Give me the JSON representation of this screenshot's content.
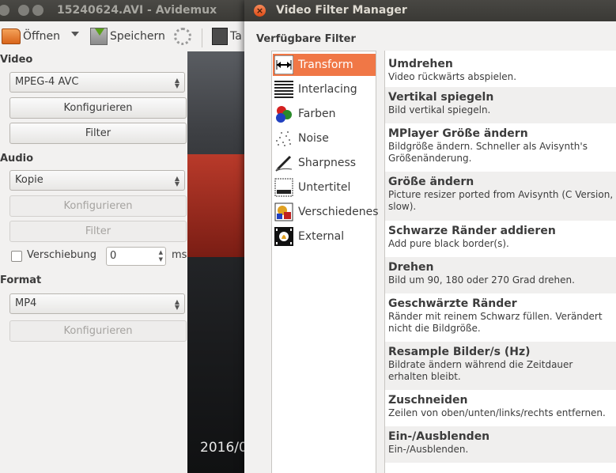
{
  "main_window": {
    "title": "15240624.AVI - Avidemux",
    "toolbar": {
      "open_label": "Öffnen",
      "save_label": "Speichern",
      "calc_label": "Ta"
    },
    "video": {
      "section_label": "Video",
      "codec_value": "MPEG-4 AVC",
      "configure_label": "Konfigurieren",
      "filter_label": "Filter"
    },
    "audio": {
      "section_label": "Audio",
      "codec_value": "Kopie",
      "configure_label": "Konfigurieren",
      "filter_label": "Filter",
      "shift_label": "Verschiebung",
      "shift_value": "0",
      "shift_unit": "ms"
    },
    "format": {
      "section_label": "Format",
      "container_value": "MP4",
      "configure_label": "Konfigurieren"
    },
    "preview": {
      "timestamp": "2016/0"
    }
  },
  "dialog": {
    "title": "Video Filter Manager",
    "available_label": "Verfügbare Filter",
    "categories": [
      {
        "label": "Transform",
        "icon": "transform-icon",
        "selected": true
      },
      {
        "label": "Interlacing",
        "icon": "interlacing-icon",
        "selected": false
      },
      {
        "label": "Farben",
        "icon": "colors-icon",
        "selected": false
      },
      {
        "label": "Noise",
        "icon": "noise-icon",
        "selected": false
      },
      {
        "label": "Sharpness",
        "icon": "sharpness-icon",
        "selected": false
      },
      {
        "label": "Untertitel",
        "icon": "subtitle-icon",
        "selected": false
      },
      {
        "label": "Verschiedenes",
        "icon": "misc-icon",
        "selected": false
      },
      {
        "label": "External",
        "icon": "external-icon",
        "selected": false
      }
    ],
    "filters": [
      {
        "name": "Umdrehen",
        "description": "Video rückwärts abspielen."
      },
      {
        "name": "Vertikal spiegeln",
        "description": "Bild vertikal spiegeln."
      },
      {
        "name": "MPlayer Größe ändern",
        "description": "Bildgröße ändern. Schneller als Avisynth's Größenänderung."
      },
      {
        "name": "Größe ändern",
        "description": "Picture resizer ported from Avisynth (C Version, slow)."
      },
      {
        "name": "Schwarze Ränder addieren",
        "description": "Add pure black border(s)."
      },
      {
        "name": "Drehen",
        "description": "Bild um 90, 180 oder 270 Grad drehen."
      },
      {
        "name": "Geschwärzte Ränder",
        "description": "Ränder mit reinem Schwarz füllen. Verändert nicht die Bildgröße."
      },
      {
        "name": "Resample Bilder/s (Hz)",
        "description": "Bildrate ändern während die Zeitdauer erhalten bleibt."
      },
      {
        "name": "Zuschneiden",
        "description": "Zeilen von oben/unten/links/rechts entfernen."
      },
      {
        "name": "Ein-/Ausblenden",
        "description": "Ein-/Ausblenden."
      }
    ],
    "colors": {
      "selection": "#f07746",
      "close_button": "#df4b16"
    }
  }
}
